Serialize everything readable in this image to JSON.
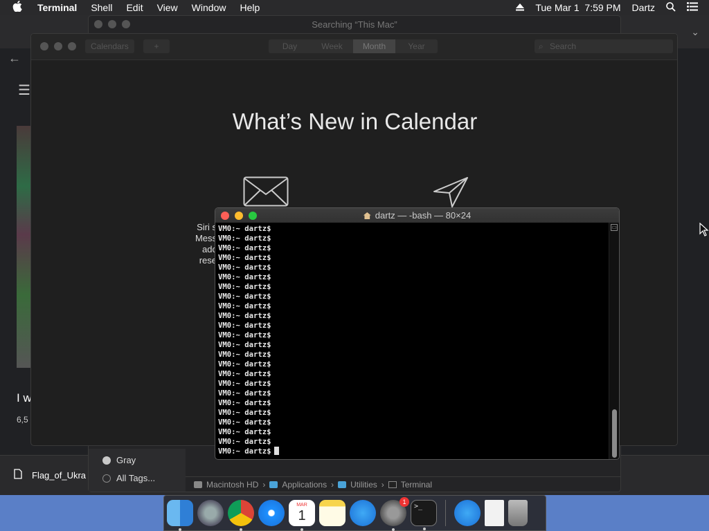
{
  "menubar": {
    "app_name": "Terminal",
    "items": [
      "Shell",
      "Edit",
      "View",
      "Window",
      "Help"
    ],
    "datetime": "Tue Mar 1  7:59 PM",
    "user": "Dartz"
  },
  "browser": {
    "snippet_title": "I w",
    "snippet_meta": "6,5",
    "download_file": "Flag_of_Ukra"
  },
  "finder": {
    "title": "Searching “This Mac”",
    "tags": [
      {
        "label": "Gray"
      },
      {
        "label": "All Tags..."
      }
    ],
    "path": [
      "Macintosh HD",
      "Applications",
      "Utilities",
      "Terminal"
    ]
  },
  "calendar": {
    "calendars_button": "Calendars",
    "add_button": "+",
    "views": [
      "Day",
      "Week",
      "Month",
      "Year"
    ],
    "selected_view": "Month",
    "search_placeholder": "Search",
    "heading": "What’s New in Calendar",
    "siri_lines": [
      "Siri s",
      "Mess",
      "adc",
      "rese"
    ]
  },
  "terminal": {
    "title": "dartz — -bash — 80×24",
    "prompt": "VM0:~ dartz$",
    "line_count": 24
  },
  "dock": {
    "apps": [
      {
        "name": "Finder",
        "icon": "finder-icon",
        "running": true
      },
      {
        "name": "Launchpad",
        "icon": "launchpad-icon",
        "running": false
      },
      {
        "name": "Chrome",
        "icon": "chrome-icon",
        "running": true
      },
      {
        "name": "Safari",
        "icon": "safari-icon",
        "running": false
      },
      {
        "name": "Calendar",
        "icon": "calendar-icon",
        "running": true,
        "month": "MAR",
        "day": "1"
      },
      {
        "name": "Notes",
        "icon": "notes-icon",
        "running": false
      },
      {
        "name": "App Store",
        "icon": "app-store-icon",
        "running": false
      },
      {
        "name": "System Preferences",
        "icon": "system-preferences-icon",
        "running": true,
        "badge": "1"
      },
      {
        "name": "Terminal",
        "icon": "terminal-icon",
        "running": true
      },
      {
        "name": "App Store Downloads",
        "icon": "app-store-icon",
        "running": false
      },
      {
        "name": "Document",
        "icon": "document-icon",
        "running": false
      },
      {
        "name": "Trash",
        "icon": "trash-icon",
        "running": false
      }
    ]
  },
  "colors": {
    "close": "#fe5f57",
    "minimize": "#febc2e",
    "zoom": "#28c840",
    "desktop": "#5a7fc7"
  }
}
